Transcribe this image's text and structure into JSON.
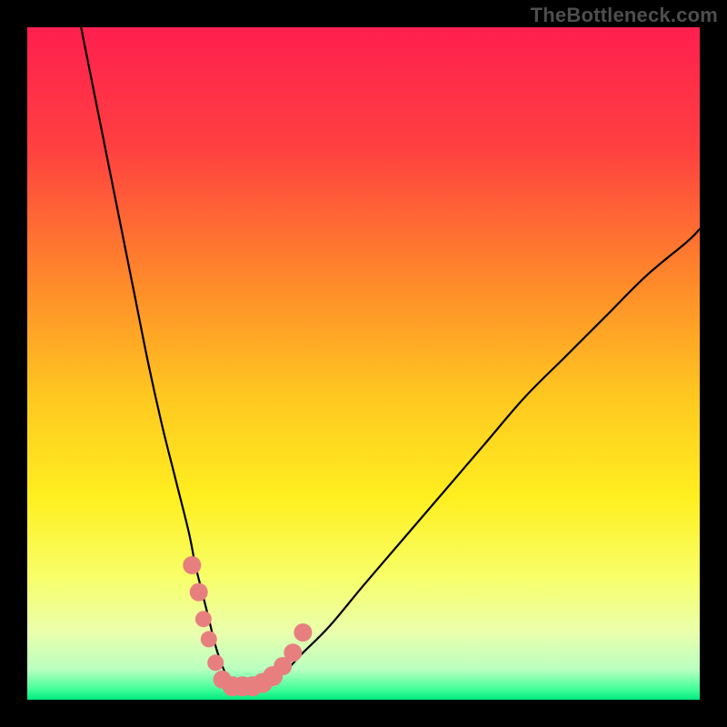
{
  "watermark": "TheBottleneck.com",
  "chart_data": {
    "type": "line",
    "title": "",
    "xlabel": "",
    "ylabel": "",
    "xlim": [
      0,
      100
    ],
    "ylim": [
      0,
      100
    ],
    "background": {
      "type": "vertical-gradient",
      "stops": [
        {
          "pos": 0.0,
          "color": "#ff1f4f"
        },
        {
          "pos": 0.18,
          "color": "#ff4040"
        },
        {
          "pos": 0.38,
          "color": "#ff8a2a"
        },
        {
          "pos": 0.55,
          "color": "#ffc820"
        },
        {
          "pos": 0.7,
          "color": "#ffef20"
        },
        {
          "pos": 0.82,
          "color": "#f7ff6a"
        },
        {
          "pos": 0.9,
          "color": "#eaffad"
        },
        {
          "pos": 0.955,
          "color": "#b9ffc0"
        },
        {
          "pos": 0.985,
          "color": "#40ff98"
        },
        {
          "pos": 1.0,
          "color": "#00e880"
        }
      ]
    },
    "series": [
      {
        "name": "left-branch",
        "x": [
          8,
          10,
          12,
          14,
          16,
          18,
          20,
          22,
          24,
          25,
          26,
          27,
          28,
          29,
          30,
          31
        ],
        "y": [
          100,
          90,
          80,
          70,
          60,
          50,
          41,
          33,
          25,
          20,
          16,
          12,
          8,
          5,
          3,
          2
        ]
      },
      {
        "name": "right-branch",
        "x": [
          31,
          33,
          35,
          38,
          41,
          45,
          50,
          56,
          62,
          68,
          74,
          80,
          86,
          92,
          98,
          100
        ],
        "y": [
          2,
          2,
          3,
          4,
          7,
          11,
          17,
          24,
          31,
          38,
          45,
          51,
          57,
          63,
          68,
          70
        ]
      }
    ],
    "markers": [
      {
        "x": 24.5,
        "y": 20,
        "r": 10
      },
      {
        "x": 25.5,
        "y": 16,
        "r": 10
      },
      {
        "x": 26.2,
        "y": 12,
        "r": 9
      },
      {
        "x": 27.0,
        "y": 9,
        "r": 9
      },
      {
        "x": 28.0,
        "y": 5.5,
        "r": 9
      },
      {
        "x": 29.0,
        "y": 3,
        "r": 10
      },
      {
        "x": 30.5,
        "y": 2,
        "r": 11
      },
      {
        "x": 32.0,
        "y": 2,
        "r": 11
      },
      {
        "x": 33.5,
        "y": 2,
        "r": 11
      },
      {
        "x": 35.0,
        "y": 2.5,
        "r": 11
      },
      {
        "x": 36.5,
        "y": 3.5,
        "r": 11
      },
      {
        "x": 38.0,
        "y": 5,
        "r": 10
      },
      {
        "x": 39.5,
        "y": 7,
        "r": 10
      },
      {
        "x": 41.0,
        "y": 10,
        "r": 10
      }
    ],
    "marker_color": "#e77f7f",
    "curve_color": "#000000"
  }
}
